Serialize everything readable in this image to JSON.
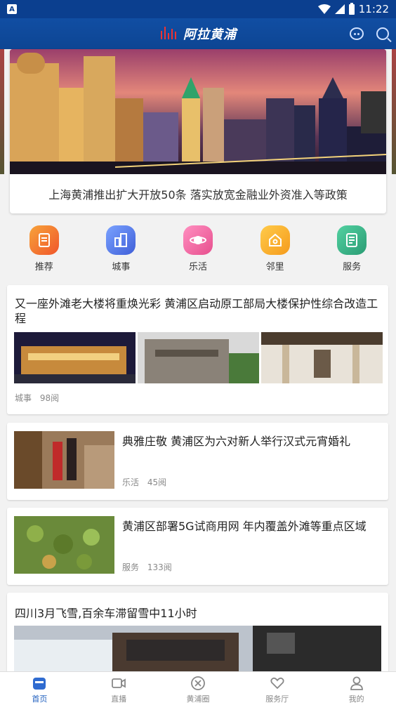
{
  "status_bar": {
    "time": "11:22"
  },
  "app": {
    "title": "阿拉黄浦"
  },
  "banner": {
    "caption": "上海黄浦推出扩大开放50条 落实放宽金融业外资准入等政策"
  },
  "categories": [
    {
      "label": "推荐",
      "icon": "document-icon",
      "color": "#f5742b"
    },
    {
      "label": "城事",
      "icon": "building-icon",
      "color": "#4d7be8"
    },
    {
      "label": "乐活",
      "icon": "planet-icon",
      "color": "#f06aa0"
    },
    {
      "label": "邻里",
      "icon": "home-icon",
      "color": "#f7b22c"
    },
    {
      "label": "服务",
      "icon": "notepad-icon",
      "color": "#37b387"
    }
  ],
  "feed": [
    {
      "title": "又一座外滩老大楼将重焕光彩 黄浦区启动原工部局大楼保护性综合改造工程",
      "category": "城事",
      "reads": "98阅"
    },
    {
      "title": "典雅庄敬 黄浦区为六对新人举行汉式元宵婚礼",
      "category": "乐活",
      "reads": "45阅"
    },
    {
      "title": "黄浦区部署5G试商用网 年内覆盖外滩等重点区域",
      "category": "服务",
      "reads": "133阅"
    },
    {
      "title": "四川3月飞雪,百余车滞留雪中11小时"
    }
  ],
  "bottom_nav": [
    {
      "label": "首页",
      "icon": "home-tab-icon",
      "active": true
    },
    {
      "label": "直播",
      "icon": "video-icon",
      "active": false
    },
    {
      "label": "黄浦圈",
      "icon": "compass-icon",
      "active": false
    },
    {
      "label": "服务厅",
      "icon": "heart-hands-icon",
      "active": false
    },
    {
      "label": "我的",
      "icon": "user-icon",
      "active": false
    }
  ],
  "colors": {
    "header": "#114ea3",
    "accent": "#1f5fbf"
  }
}
